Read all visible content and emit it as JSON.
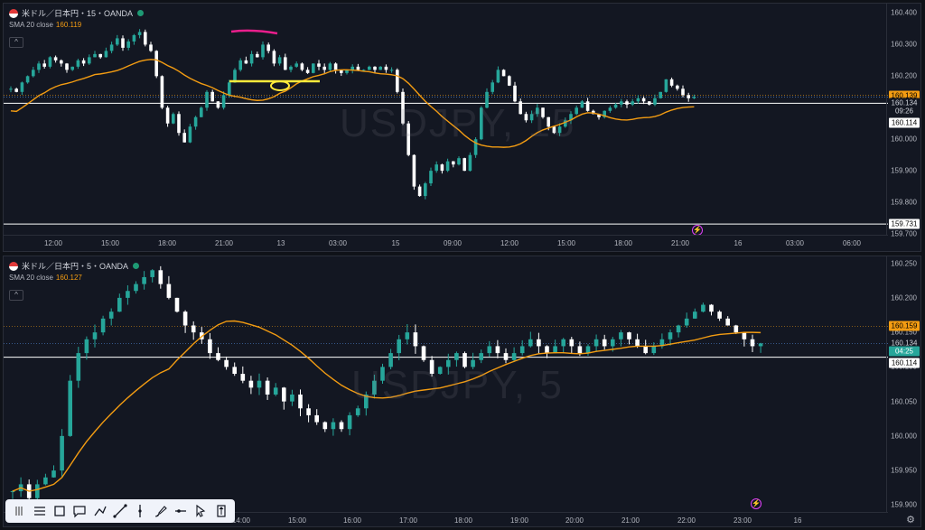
{
  "top": {
    "symbol": "米ドル／日本円・15・OANDA",
    "sma_label": "SMA 20 close",
    "sma_value": "160.119",
    "watermark": "USDJPY, 15",
    "y_ticks": [
      "160.400",
      "160.300",
      "160.200",
      "160.100",
      "160.000",
      "159.900",
      "159.800",
      "159.700"
    ],
    "y_range": [
      159.7,
      160.43
    ],
    "x_ticks": [
      "12:00",
      "15:00",
      "18:00",
      "21:00",
      "13",
      "03:00",
      "15",
      "09:00",
      "12:00",
      "15:00",
      "18:00",
      "21:00",
      "16",
      "03:00",
      "06:00"
    ],
    "tags": {
      "sma": "160.139",
      "price": "160.134",
      "countdown": "09:26",
      "level": "160.114",
      "low": "159.731"
    },
    "h_lines": [
      160.114,
      159.731
    ]
  },
  "bottom": {
    "symbol": "米ドル／日本円・5・OANDA",
    "sma_label": "SMA 20 close",
    "sma_value": "160.127",
    "watermark": "USDJPY, 5",
    "y_ticks": [
      "160.250",
      "160.200",
      "160.150",
      "160.100",
      "160.050",
      "160.000",
      "159.950",
      "159.900"
    ],
    "y_range": [
      159.89,
      160.26
    ],
    "x_ticks": [
      "14:00",
      "15:00",
      "16:00",
      "17:00",
      "18:00",
      "19:00",
      "20:00",
      "21:00",
      "22:00",
      "23:00",
      "16"
    ],
    "tags": {
      "sma": "160.159",
      "price": "160.134",
      "countdown": "04:25",
      "level": "160.114"
    },
    "h_lines": [
      160.114
    ]
  },
  "colors": {
    "up": "#26a69a",
    "down": "#ffffff",
    "sma": "#f39c12",
    "bg": "#131722",
    "magenta": "#e91e8c",
    "yellow": "#ffeb3b"
  },
  "toolbar": {
    "items": [
      "drag-handle-icon",
      "lines-icon",
      "rectangle-icon",
      "comment-icon",
      "path-icon",
      "trend-line-icon",
      "vertical-line-icon",
      "brush-icon",
      "horizontal-ray-icon",
      "cursor-icon",
      "price-range-icon"
    ]
  },
  "chart_data": [
    {
      "type": "candlestick",
      "title": "米ドル／日本円・15・OANDA",
      "indicator": "SMA 20 close",
      "ylim": [
        159.7,
        160.43
      ],
      "series": [
        {
          "name": "SMA 20 close",
          "last": 160.119
        }
      ],
      "last_price": 160.134,
      "low_marker": 159.731
    },
    {
      "type": "candlestick",
      "title": "米ドル／日本円・5・OANDA",
      "indicator": "SMA 20 close",
      "ylim": [
        159.89,
        160.26
      ],
      "series": [
        {
          "name": "SMA 20 close",
          "last": 160.127
        }
      ],
      "last_price": 160.134
    }
  ]
}
